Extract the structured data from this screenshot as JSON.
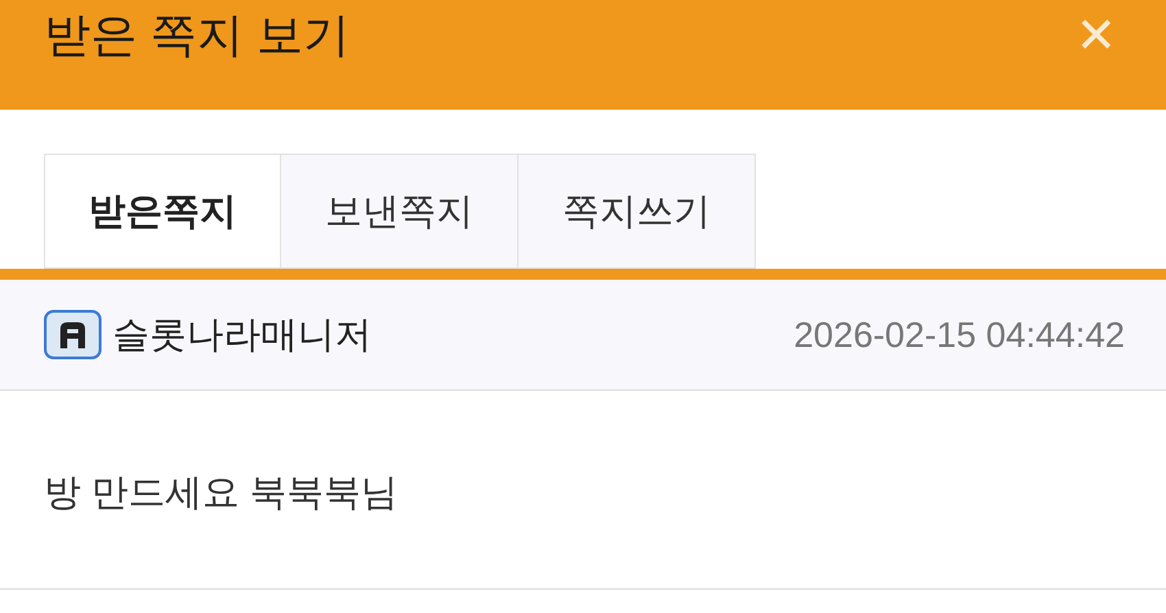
{
  "window": {
    "title": "받은 쪽지 보기",
    "close": "✕"
  },
  "tabs": [
    {
      "label": "받은쪽지",
      "selected": true
    },
    {
      "label": "보낸쪽지",
      "selected": false
    },
    {
      "label": "쪽지쓰기",
      "selected": false
    }
  ],
  "message": {
    "sender": "슬롯나라매니저",
    "date": "2026-02-15 04:44:42",
    "body": "방 만드세요 북북북님"
  }
}
